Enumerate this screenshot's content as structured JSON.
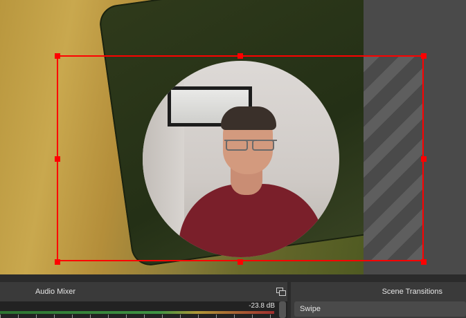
{
  "preview": {
    "selected_source": "webcam-circle"
  },
  "audio_mixer": {
    "title": "Audio Mixer",
    "level_db": "-23.8 dB"
  },
  "scene_transitions": {
    "title": "Scene Transitions",
    "selected": "Swipe"
  },
  "colors": {
    "selection": "#ff0000",
    "panel_bg": "#3a3a3a",
    "canvas_outside": "#4a4a4a"
  }
}
